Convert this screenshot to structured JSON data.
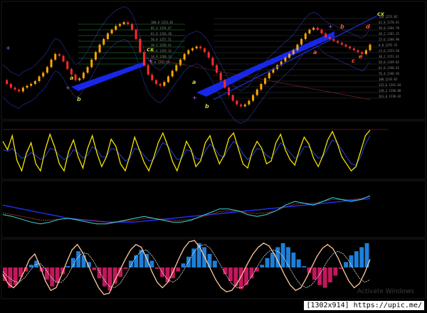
{
  "chart_data": [
    {
      "type": "line",
      "panel": "price",
      "xlabel": "",
      "ylabel": "",
      "price_points": [
        96,
        92,
        88,
        86,
        84,
        88,
        90,
        92,
        95,
        100,
        104,
        110,
        118,
        124,
        122,
        116,
        108,
        102,
        96,
        98,
        104,
        110,
        118,
        126,
        134,
        140,
        146,
        150,
        154,
        156,
        158,
        156,
        150,
        140,
        126,
        112,
        102,
        96,
        92,
        90,
        94,
        100,
        106,
        112,
        118,
        124,
        128,
        130,
        132,
        130,
        126,
        120,
        112,
        104,
        96,
        88,
        80,
        74,
        70,
        68,
        70,
        74,
        80,
        86,
        92,
        98,
        104,
        108,
        112,
        116,
        120,
        124,
        128,
        134,
        140,
        146,
        150,
        152,
        150,
        146,
        142,
        140,
        138,
        136,
        134,
        132,
        130,
        128,
        126,
        124,
        128,
        134
      ],
      "fib_levels": [
        "100.0 1253.82",
        "85.4 1254.47",
        "61.8 1256.38",
        "50.0 1257.51",
        "38.2 1258.41",
        "23.6 1259.32",
        "14.6 1260.13",
        "0.0 1261.18"
      ],
      "fib_levels_right": [
        "100 1253.82",
        "61.8 1270.41",
        "50.0 1264.78",
        "38.2 1262.15",
        "23.6 1260.90",
        "0.0 1255.25",
        "23.6 1253.50",
        "38.2 1251.41",
        "50.0 1249.82",
        "61.8 1248.41",
        "76.4 1246.50",
        "100 1243.82",
        "123.6 1241.64",
        "138.2 1240.08",
        "161.8 1238.42"
      ],
      "wave_labels": [
        {
          "text": "b",
          "color": "#c9d24a"
        },
        {
          "text": "a",
          "color": "#c9d24a"
        },
        {
          "text": "cx",
          "color": "#c9d24a"
        },
        {
          "text": "a",
          "color": "#c9d24a"
        },
        {
          "text": "b",
          "color": "#c9d24a"
        },
        {
          "text": "a",
          "color": "#ff5533"
        },
        {
          "text": "b",
          "color": "#ff5533"
        },
        {
          "text": "c",
          "color": "#ff5533"
        },
        {
          "text": "d",
          "color": "#ff5533"
        },
        {
          "text": "e",
          "color": "#ff5533"
        },
        {
          "text": "cx",
          "color": "#c9d24a"
        }
      ],
      "colors": {
        "up": "#ffa500",
        "down": "#ff2a2a",
        "channel": "#1a2bff",
        "fib": "#3fa83f"
      }
    },
    {
      "type": "line",
      "panel": "oscillator",
      "series": [
        {
          "values": [
            72,
            60,
            80,
            45,
            30,
            55,
            70,
            40,
            30,
            60,
            82,
            64,
            40,
            30,
            58,
            74,
            50,
            34,
            62,
            80,
            55,
            36,
            50,
            75,
            65,
            40,
            30,
            52,
            78,
            60,
            42,
            30,
            48,
            70,
            84,
            66,
            44,
            30,
            50,
            72,
            60,
            36,
            44,
            70,
            80,
            58,
            40,
            52,
            76,
            84,
            62,
            40,
            34,
            58,
            72,
            62,
            40,
            44,
            70,
            82,
            60,
            46,
            38,
            60,
            78,
            68,
            48,
            36,
            52,
            74,
            86,
            70,
            50,
            40,
            30,
            36,
            58,
            80,
            88
          ]
        },
        {
          "values": [
            60,
            58,
            62,
            55,
            48,
            50,
            56,
            52,
            46,
            50,
            62,
            60,
            52,
            46,
            50,
            60,
            56,
            48,
            52,
            64,
            60,
            50,
            50,
            62,
            60,
            52,
            44,
            48,
            62,
            60,
            52,
            44,
            46,
            58,
            70,
            66,
            56,
            46,
            48,
            60,
            58,
            48,
            46,
            58,
            68,
            62,
            52,
            50,
            62,
            72,
            66,
            54,
            46,
            52,
            62,
            60,
            52,
            48,
            58,
            70,
            64,
            56,
            48,
            52,
            64,
            64,
            56,
            48,
            50,
            62,
            74,
            70,
            60,
            50,
            40,
            38,
            50,
            68,
            80
          ]
        }
      ],
      "colors": {
        "main": "#f5e400",
        "signal": "#2a55ff",
        "level": "#b02a2a"
      }
    },
    {
      "type": "line",
      "panel": "ma-band",
      "series": [
        {
          "values": [
            60,
            58,
            55,
            52,
            50,
            52,
            55,
            56,
            54,
            52,
            50,
            50,
            52,
            54,
            56,
            58,
            56,
            54,
            52,
            52,
            54,
            58,
            62,
            66,
            66,
            64,
            60,
            58,
            60,
            64,
            70,
            74,
            72,
            70,
            74,
            78,
            76,
            74,
            76,
            80
          ]
        },
        {
          "values": [
            62,
            60,
            58,
            56,
            54,
            54,
            55,
            56,
            55,
            54,
            53,
            52,
            52,
            53,
            54,
            56,
            56,
            55,
            54,
            54,
            55,
            57,
            60,
            63,
            64,
            64,
            62,
            61,
            62,
            64,
            68,
            71,
            72,
            72,
            74,
            76,
            76,
            76,
            77,
            79
          ]
        },
        {
          "values": [
            70,
            68,
            66,
            64,
            62,
            60,
            58,
            56,
            55,
            54,
            53,
            52,
            52,
            52,
            52,
            53,
            54,
            55,
            56,
            57,
            58,
            59,
            60,
            61,
            62,
            63,
            64,
            65,
            66,
            67,
            68,
            69,
            70,
            71,
            72,
            73,
            74,
            75,
            76,
            77
          ]
        }
      ],
      "colors": {
        "fast": "#39e0d0",
        "slow": "#d04040",
        "long": "#2030ff"
      }
    },
    {
      "type": "bar",
      "panel": "histogram",
      "values": [
        -20,
        -30,
        -26,
        -14,
        -6,
        4,
        10,
        -6,
        -18,
        -28,
        -22,
        -10,
        2,
        14,
        24,
        18,
        8,
        -4,
        -16,
        -28,
        -34,
        -24,
        -14,
        -2,
        10,
        18,
        26,
        20,
        10,
        -2,
        -14,
        -22,
        -16,
        -6,
        6,
        16,
        28,
        36,
        30,
        20,
        10,
        0,
        -10,
        -20,
        -28,
        -32,
        -26,
        -16,
        -6,
        4,
        14,
        22,
        30,
        36,
        30,
        22,
        12,
        2,
        -8,
        -18,
        -26,
        -30,
        -22,
        -12,
        -2,
        8,
        18,
        24,
        30,
        36
      ],
      "line_main": [
        -10,
        -24,
        -30,
        -22,
        -6,
        12,
        20,
        2,
        -20,
        -34,
        -30,
        -12,
        8,
        26,
        34,
        22,
        4,
        -14,
        -30,
        -40,
        -38,
        -20,
        -4,
        12,
        26,
        34,
        30,
        14,
        -6,
        -22,
        -30,
        -22,
        -6,
        12,
        28,
        38,
        40,
        30,
        14,
        -2,
        -18,
        -30,
        -36,
        -34,
        -24,
        -10,
        6,
        20,
        30,
        36,
        32,
        20,
        4,
        -12,
        -26,
        -34,
        -30,
        -16,
        0,
        16,
        28,
        34,
        28,
        14,
        -4,
        -20,
        -30,
        -24,
        -8,
        12
      ],
      "line_signal": [
        -6,
        -14,
        -20,
        -22,
        -16,
        -6,
        4,
        6,
        -2,
        -14,
        -22,
        -22,
        -14,
        0,
        14,
        22,
        20,
        10,
        -4,
        -18,
        -28,
        -30,
        -24,
        -12,
        2,
        16,
        24,
        26,
        18,
        6,
        -8,
        -18,
        -22,
        -16,
        -4,
        10,
        24,
        32,
        34,
        28,
        16,
        2,
        -12,
        -24,
        -30,
        -30,
        -22,
        -10,
        4,
        16,
        24,
        26,
        22,
        12,
        -2,
        -16,
        -26,
        -30,
        -26,
        -16,
        -4,
        10,
        20,
        24,
        20,
        10,
        -4,
        -16,
        -22,
        -18
      ],
      "colors": {
        "pos": "#1e7fd8",
        "neg": "#c2185b",
        "main": "#ffc89a",
        "signal": "#ffffff"
      }
    }
  ],
  "watermark": "Activate Windows",
  "badge": "[1302x914] https://upic.me/"
}
